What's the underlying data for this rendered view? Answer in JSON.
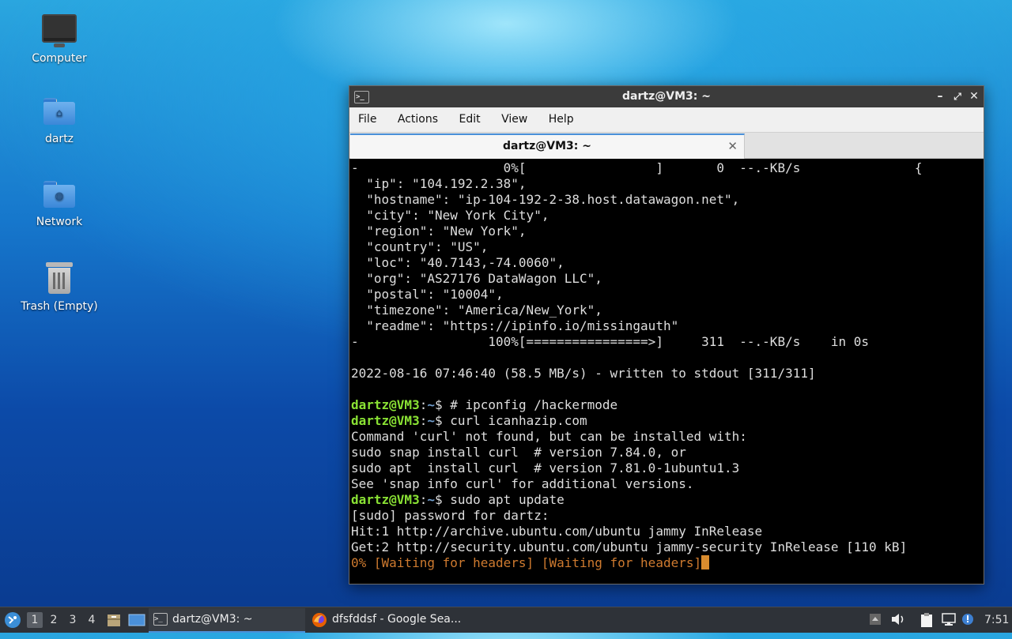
{
  "desktop": {
    "icons": [
      {
        "label": "Computer",
        "icon": "monitor-icon"
      },
      {
        "label": "dartz",
        "icon": "home-folder-icon"
      },
      {
        "label": "Network",
        "icon": "network-folder-icon"
      },
      {
        "label": "Trash (Empty)",
        "icon": "trash-icon"
      }
    ]
  },
  "window": {
    "title": "dartz@VM3: ~",
    "menu": [
      "File",
      "Actions",
      "Edit",
      "View",
      "Help"
    ],
    "tab_label": "dartz@VM3: ~",
    "controls": {
      "minimize": "–",
      "maximize": "⤢",
      "close": "✕"
    }
  },
  "terminal": {
    "lines": [
      {
        "text": "-                   0%[                 ]       0  --.-KB/s               {"
      },
      {
        "text": "  \"ip\": \"104.192.2.38\","
      },
      {
        "text": "  \"hostname\": \"ip-104-192-2-38.host.datawagon.net\","
      },
      {
        "text": "  \"city\": \"New York City\","
      },
      {
        "text": "  \"region\": \"New York\","
      },
      {
        "text": "  \"country\": \"US\","
      },
      {
        "text": "  \"loc\": \"40.7143,-74.0060\","
      },
      {
        "text": "  \"org\": \"AS27176 DataWagon LLC\","
      },
      {
        "text": "  \"postal\": \"10004\","
      },
      {
        "text": "  \"timezone\": \"America/New_York\","
      },
      {
        "text": "  \"readme\": \"https://ipinfo.io/missingauth\""
      },
      {
        "text": "-                 100%[================>]     311  --.-KB/s    in 0s"
      },
      {
        "text": ""
      },
      {
        "text": "2022-08-16 07:46:40 (58.5 MB/s) - written to stdout [311/311]"
      },
      {
        "text": ""
      },
      {
        "prompt_user": "dartz@VM3",
        "prompt_sep": ":",
        "prompt_dir": "~",
        "prompt_end": "$ ",
        "text": "# ipconfig /hackermode"
      },
      {
        "prompt_user": "dartz@VM3",
        "prompt_sep": ":",
        "prompt_dir": "~",
        "prompt_end": "$ ",
        "text": "curl icanhazip.com"
      },
      {
        "text": "Command 'curl' not found, but can be installed with:"
      },
      {
        "text": "sudo snap install curl  # version 7.84.0, or"
      },
      {
        "text": "sudo apt  install curl  # version 7.81.0-1ubuntu1.3"
      },
      {
        "text": "See 'snap info curl' for additional versions."
      },
      {
        "prompt_user": "dartz@VM3",
        "prompt_sep": ":",
        "prompt_dir": "~",
        "prompt_end": "$ ",
        "text": "sudo apt update"
      },
      {
        "text": "[sudo] password for dartz:"
      },
      {
        "text": "Hit:1 http://archive.ubuntu.com/ubuntu jammy InRelease"
      },
      {
        "text": "Get:2 http://security.ubuntu.com/ubuntu jammy-security InRelease [110 kB]"
      },
      {
        "text": "0% [Waiting for headers] [Waiting for headers]",
        "style": "orange",
        "cursor": true
      }
    ]
  },
  "taskbar": {
    "workspaces": [
      "1",
      "2",
      "3",
      "4"
    ],
    "tasks": [
      {
        "label": "dartz@VM3: ~",
        "icon": "terminal-icon",
        "active": true
      },
      {
        "label": "dfsfddsf - Google Sea...",
        "icon": "firefox-icon",
        "active": false
      }
    ],
    "clock": "7:51"
  },
  "colors": {
    "prompt_user": "#8ae234",
    "prompt_dir": "#729fcf",
    "orange_text": "#ce7a2f",
    "tab_accent": "#4a90d9"
  }
}
